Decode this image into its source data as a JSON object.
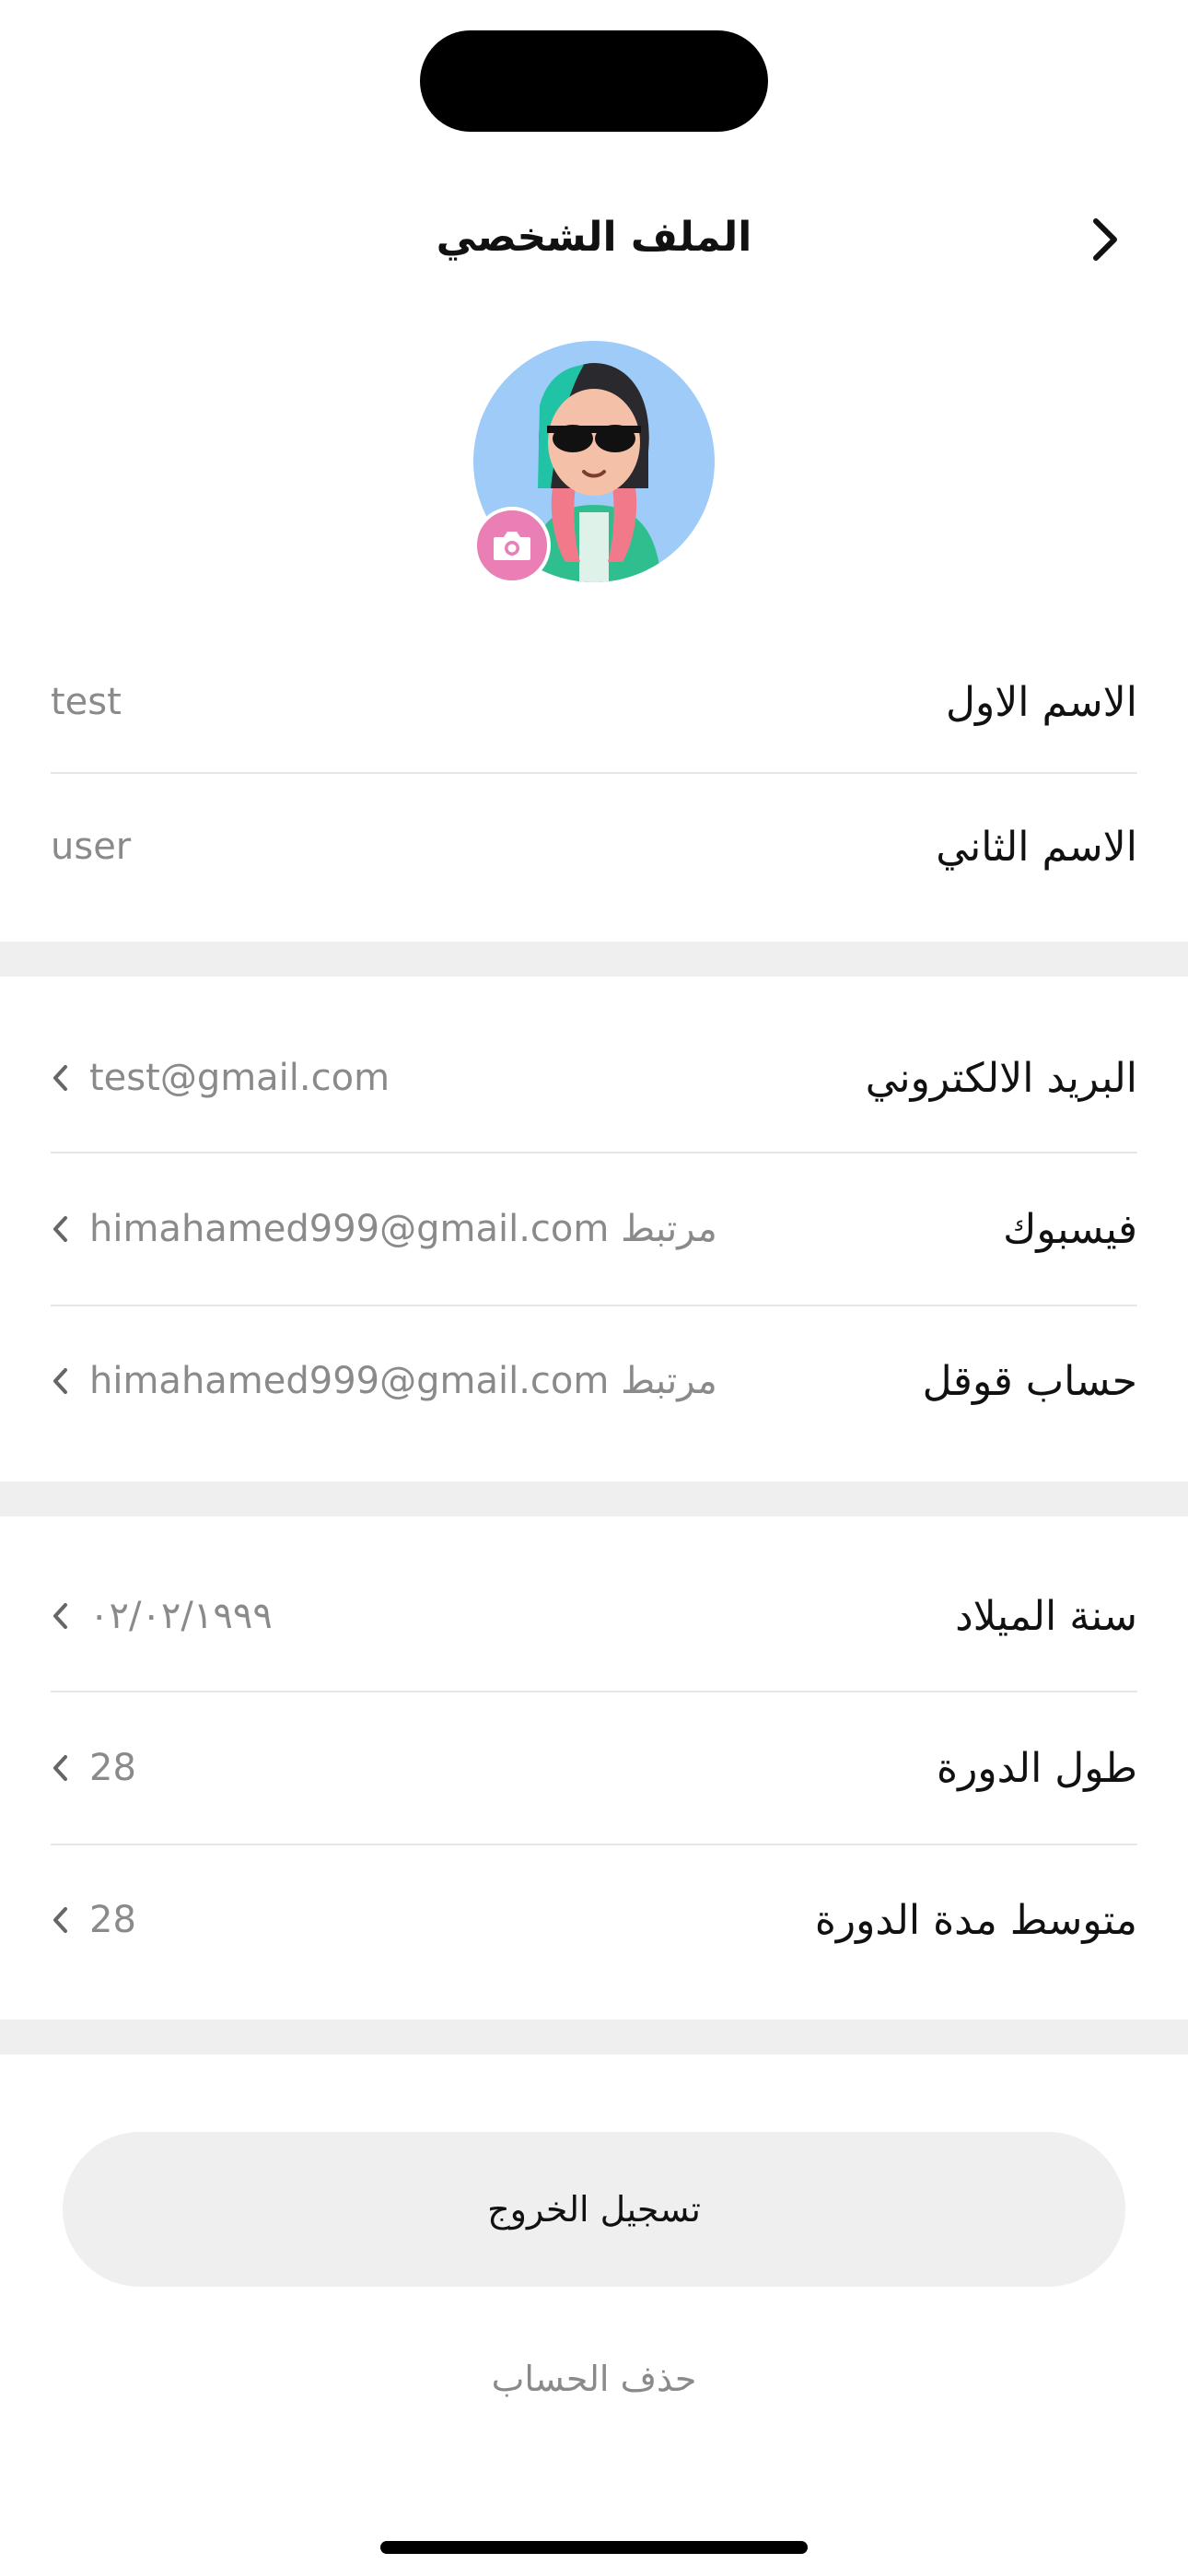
{
  "header": {
    "title": "الملف الشخصي"
  },
  "profile": {
    "first_name": {
      "label": "الاسم الاول",
      "value": "test"
    },
    "last_name": {
      "label": "الاسم الثاني",
      "value": "user"
    }
  },
  "accounts": {
    "email": {
      "label": "البريد الالكتروني",
      "value": "test@gmail.com"
    },
    "facebook": {
      "label": "فيسبوك",
      "value": "himahamed999@gmail.com مرتبط"
    },
    "google": {
      "label": "حساب قوقل",
      "value": "himahamed999@gmail.com مرتبط"
    }
  },
  "cycle": {
    "birth_year": {
      "label": "سنة الميلاد",
      "value": "٠٢/٠٢/١٩٩٩"
    },
    "cycle_length": {
      "label": "طول الدورة",
      "value": "28"
    },
    "avg_period": {
      "label": "متوسط مدة الدورة",
      "value": "28"
    }
  },
  "actions": {
    "logout": "تسجيل الخروج",
    "delete_account": "حذف الحساب"
  },
  "colors": {
    "accent_pink": "#e97fb4",
    "avatar_bg": "#9ecbf7",
    "section_band": "#efefef",
    "muted_text": "#8a8a8a"
  },
  "icons": {
    "back": "chevron-right-icon",
    "camera": "camera-icon",
    "row_chevron": "chevron-left-icon"
  }
}
